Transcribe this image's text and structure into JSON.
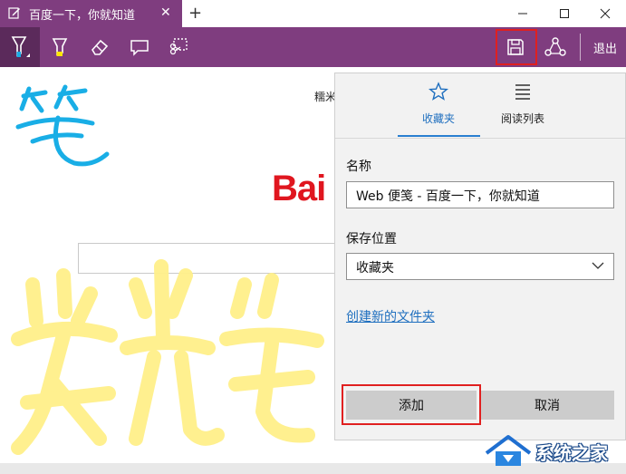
{
  "tab": {
    "title": "百度一下，你就知道",
    "close_glyph": "✕"
  },
  "new_tab_glyph": "+",
  "toolbar": {
    "exit_label": "退出"
  },
  "page": {
    "top_link": "糯米",
    "logo_text": "Bai"
  },
  "hub": {
    "tabs": [
      {
        "label": "收藏夹",
        "icon": "star-icon",
        "active": true
      },
      {
        "label": "阅读列表",
        "icon": "reading-list-icon",
        "active": false
      }
    ],
    "name_label": "名称",
    "name_value": "Web 便笺 - 百度一下，你就知道",
    "location_label": "保存位置",
    "location_value": "收藏夹",
    "new_folder_link": "创建新的文件夹",
    "add_button": "添加",
    "cancel_button": "取消"
  },
  "handwriting": {
    "pen_char": "笔",
    "highlight_text": "荧光笔"
  },
  "watermark": {
    "text": "系统之家"
  },
  "colors": {
    "accent": "#7f3d7f",
    "pen_ink": "#19aee6",
    "highlighter": "#fff08a",
    "highlight_box": "#e02020",
    "link": "#1f6fbf"
  }
}
